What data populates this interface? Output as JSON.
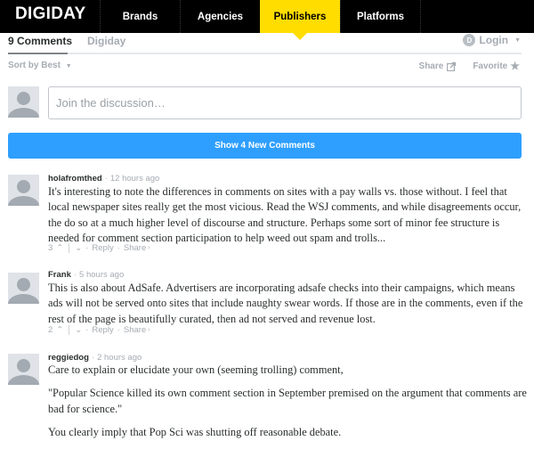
{
  "nav": {
    "logo": "DIGIDAY",
    "items": [
      {
        "label": "Brands",
        "active": false
      },
      {
        "label": "Agencies",
        "active": false
      },
      {
        "label": "Publishers",
        "active": true
      },
      {
        "label": "Platforms",
        "active": false
      }
    ],
    "accent_color": "#ffdd00"
  },
  "tabs": {
    "comments_count_label": "9 Comments",
    "forum_label": "Digiday",
    "login_label": "Login",
    "login_avatar_letter": "D"
  },
  "toolbar": {
    "sort_label": "Sort by Best",
    "share_label": "Share",
    "favorite_label": "Favorite"
  },
  "composer": {
    "placeholder": "Join the discussion…"
  },
  "show_new": {
    "label": "Show 4 New Comments",
    "color": "#2e9fff"
  },
  "comments": [
    {
      "author": "holafromthed",
      "time": "12 hours ago",
      "paragraphs": [
        "It's interesting to note the differences in comments on sites with a pay walls vs. those without. I feel that local newspaper sites really get the most vicious. Read the WSJ comments, and while disagreements occur, the do so at a much higher level of discourse and structure. Perhaps some sort of minor fee structure is needed for comment section participation to help weed out spam and trolls..."
      ],
      "votes": "3",
      "reply_label": "Reply",
      "share_label": "Share"
    },
    {
      "author": "Frank",
      "time": "5 hours ago",
      "paragraphs": [
        "This is also about AdSafe. Advertisers are incorporating adsafe checks into their campaigns, which means ads will not be served onto sites that include naughty swear words. If those are in the comments, even if the rest of the page is beautifully curated, then ad not served and revenue lost."
      ],
      "votes": "2",
      "reply_label": "Reply",
      "share_label": "Share"
    },
    {
      "author": "reggiedog",
      "time": "2 hours ago",
      "paragraphs": [
        "Care to explain or elucidate your own (seeming trolling) comment,",
        "\"Popular Science killed its own comment section in September premised on the argument that comments are bad for science.\"",
        "You clearly imply that Pop Sci was shutting off reasonable debate."
      ]
    }
  ]
}
